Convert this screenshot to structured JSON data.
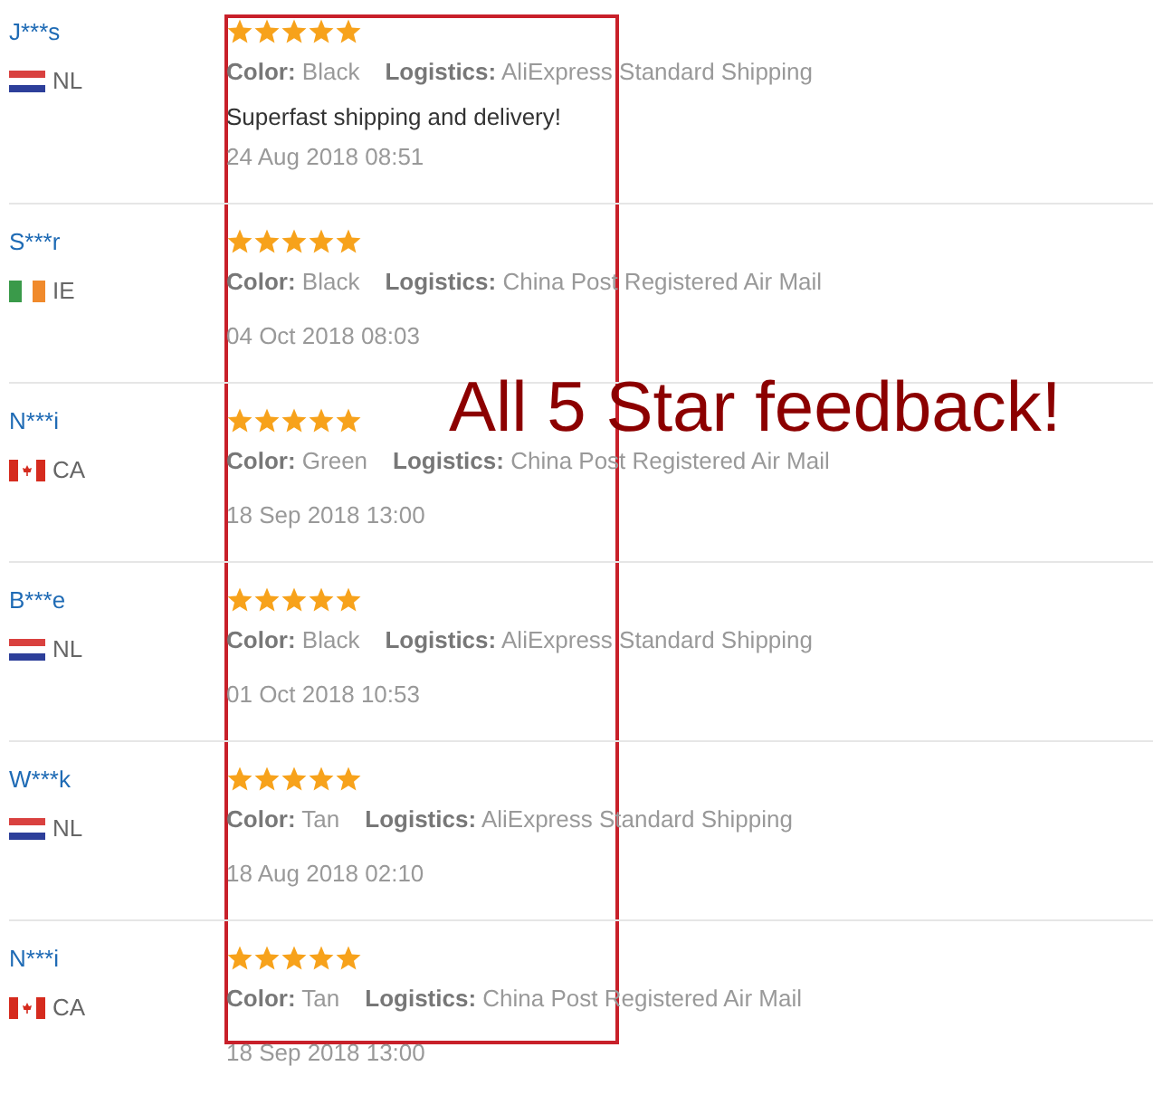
{
  "reviews": [
    {
      "name": "J***s",
      "kind": "nl",
      "country": "NL",
      "stars": 5,
      "color_label": "Color:",
      "product_color": "Black",
      "logistics_label": "Logistics:",
      "logistics": "AliExpress Standard Shipping",
      "comment": "Superfast shipping and delivery!",
      "date": "24 Aug 2018 08:51"
    },
    {
      "name": "S***r",
      "kind": "ie",
      "country": "IE",
      "stars": 5,
      "color_label": "Color:",
      "product_color": "Black",
      "logistics_label": "Logistics:",
      "logistics": "China Post Registered Air Mail",
      "date": "04 Oct 2018 08:03"
    },
    {
      "name": "N***i",
      "kind": "ca",
      "country": "CA",
      "stars": 5,
      "color_label": "Color:",
      "product_color": "Green",
      "logistics_label": "Logistics:",
      "logistics": "China Post Registered Air Mail",
      "date": "18 Sep 2018 13:00"
    },
    {
      "name": "B***e",
      "kind": "nl",
      "country": "NL",
      "stars": 5,
      "color_label": "Color:",
      "product_color": "Black",
      "logistics_label": "Logistics:",
      "logistics": "AliExpress Standard Shipping",
      "date": "01 Oct 2018 10:53"
    },
    {
      "name": "W***k",
      "kind": "nl",
      "country": "NL",
      "stars": 5,
      "color_label": "Color:",
      "product_color": "Tan",
      "logistics_label": "Logistics:",
      "logistics": "AliExpress Standard Shipping",
      "date": "18 Aug 2018 02:10"
    },
    {
      "name": "N***i",
      "kind": "ca",
      "country": "CA",
      "stars": 5,
      "color_label": "Color:",
      "product_color": "Tan",
      "logistics_label": "Logistics:",
      "logistics": "China Post Registered Air Mail",
      "date": "18 Sep 2018 13:00"
    }
  ],
  "annotation": {
    "text": "All 5 Star feedback!"
  }
}
